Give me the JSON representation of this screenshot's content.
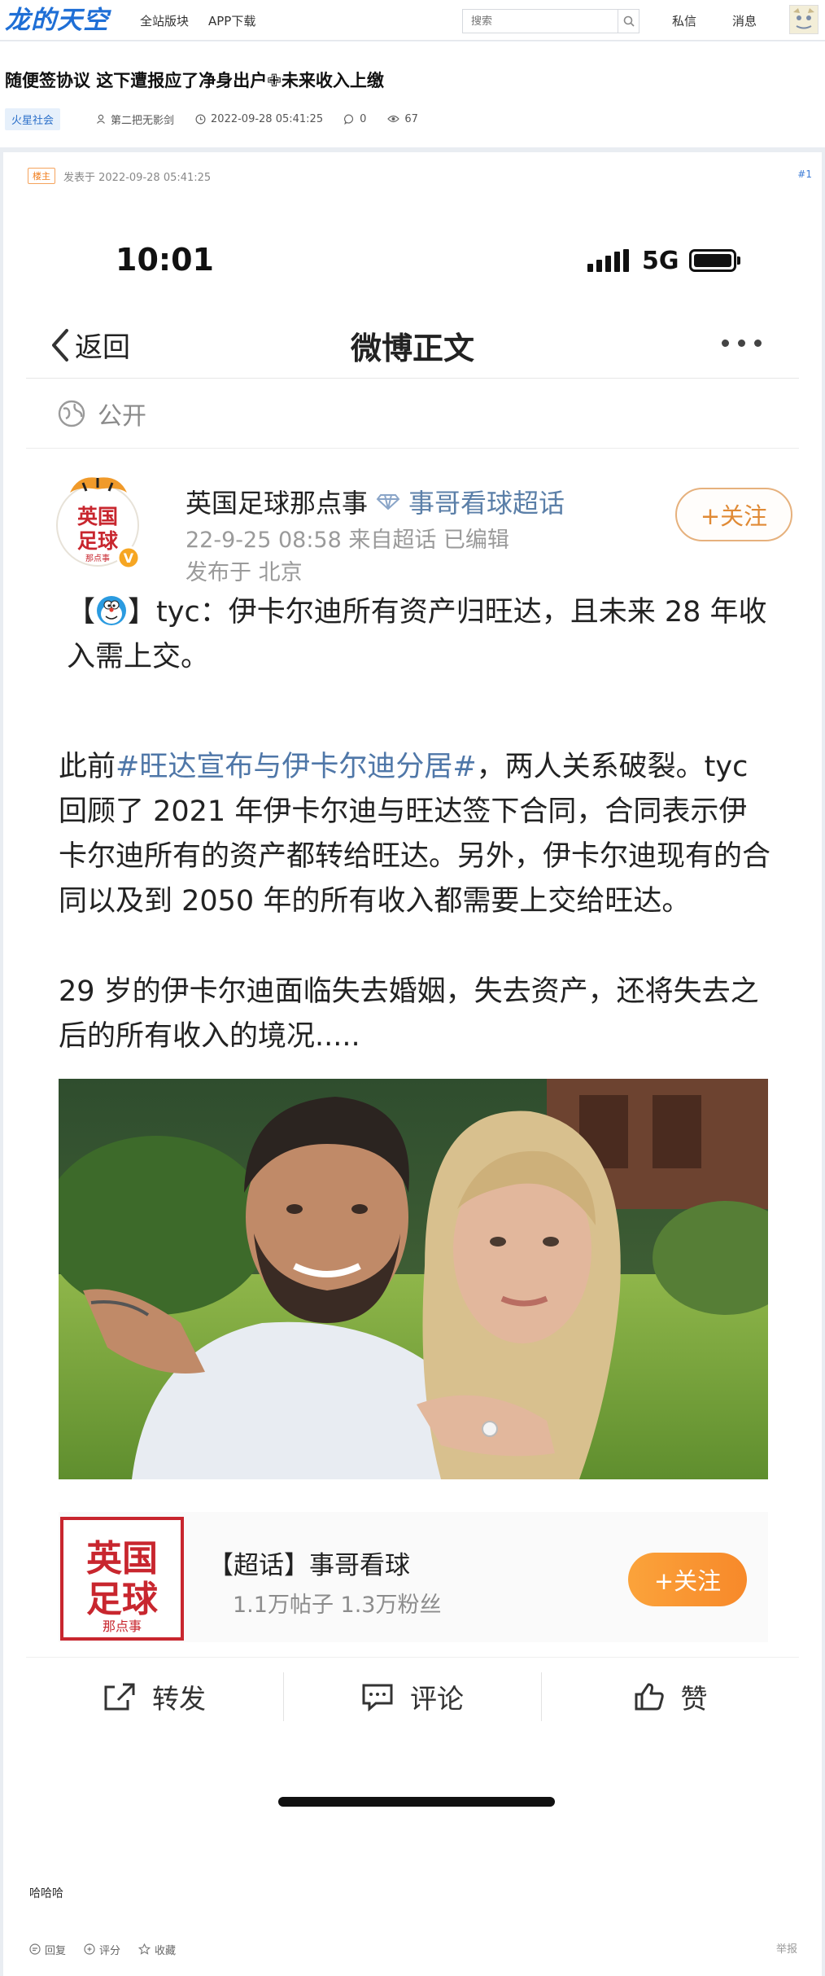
{
  "site": {
    "logo": "龙的天空",
    "nav": [
      "全站版块",
      "APP下载"
    ],
    "search_placeholder": "搜索",
    "private_msg": "私信",
    "messages": "消息"
  },
  "thread": {
    "title": "随便签协议 这下遭报应了净身出户✙未来收入上缴",
    "board": "火星社会",
    "author": "第二把无影剑",
    "time": "2022-09-28 05:41:25",
    "comments": "0",
    "views": "67"
  },
  "post": {
    "op_badge": "楼主",
    "posted_at": "发表于 2022-09-28 05:41:25",
    "floor": "#1",
    "reply_text": "哈哈哈",
    "actions": {
      "reply": "回复",
      "rate": "评分",
      "favorite": "收藏",
      "report": "举报"
    }
  },
  "screenshot": {
    "status_time": "10:01",
    "network": "5G",
    "header": {
      "back": "返回",
      "title": "微博正文"
    },
    "visibility": "公开",
    "user": {
      "name": "英国足球那点事",
      "super_topic": "事哥看球超话",
      "meta": "22-9-25 08:58  来自超话  已编辑",
      "location": "发布于 北京",
      "follow": "+关注"
    },
    "text": {
      "p1_prefix": "【",
      "p1_suffix": "】tyc：伊卡尔迪所有资产归旺达，且未来 28 年收入需上交。",
      "p2_prefix": "此前",
      "p2_topic": "#旺达宣布与伊卡尔迪分居#",
      "p2_rest": "，两人关系破裂。tyc 回顾了 2021 年伊卡尔迪与旺达签下合同，合同表示伊卡尔迪所有的资产都转给旺达。另外，伊卡尔迪现有的合同以及到 2050 年的所有收入都需要上交给旺达。",
      "p3": "29 岁的伊卡尔迪面临失去婚姻，失去资产，还将失去之后的所有收入的境况....."
    },
    "super_card": {
      "title": "【超话】事哥看球",
      "stats": "1.1万帖子 1.3万粉丝",
      "follow": "+关注"
    },
    "actions": {
      "repost": "转发",
      "comment": "评论",
      "like": "赞"
    }
  },
  "colors": {
    "logo_blue": "#1f6fd6",
    "topic_blue": "#4f77a8",
    "follow_orange": "#f7892a"
  }
}
